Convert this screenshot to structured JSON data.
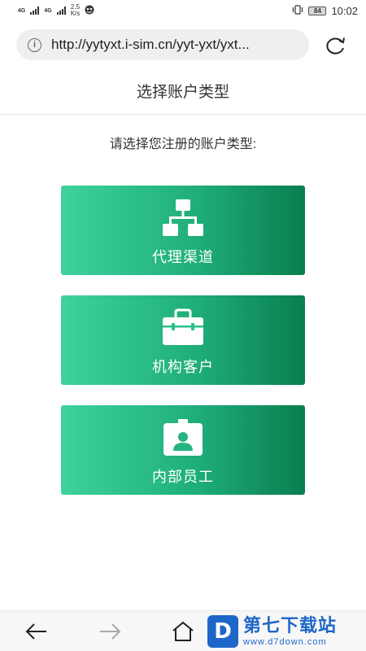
{
  "status_bar": {
    "network_1": "4G",
    "network_2": "4G",
    "speed_value": "2.5",
    "speed_unit": "K/s",
    "battery": "84",
    "time": "10:02"
  },
  "browser": {
    "url": "http://yytyxt.i-sim.cn/yyt-yxt/yxt..."
  },
  "page": {
    "title": "选择账户类型",
    "prompt": "请选择您注册的账户类型:"
  },
  "cards": [
    {
      "label": "代理渠道",
      "icon": "org-chart-icon"
    },
    {
      "label": "机构客户",
      "icon": "briefcase-icon"
    },
    {
      "label": "内部员工",
      "icon": "id-badge-icon"
    }
  ],
  "colors": {
    "card_gradient_start": "#3ed39b",
    "card_gradient_end": "#0a7e4f",
    "watermark_blue": "#1f66c9"
  },
  "watermark": {
    "logo_letter": "D",
    "name": "第七下载站",
    "url": "www.d7down.com"
  }
}
